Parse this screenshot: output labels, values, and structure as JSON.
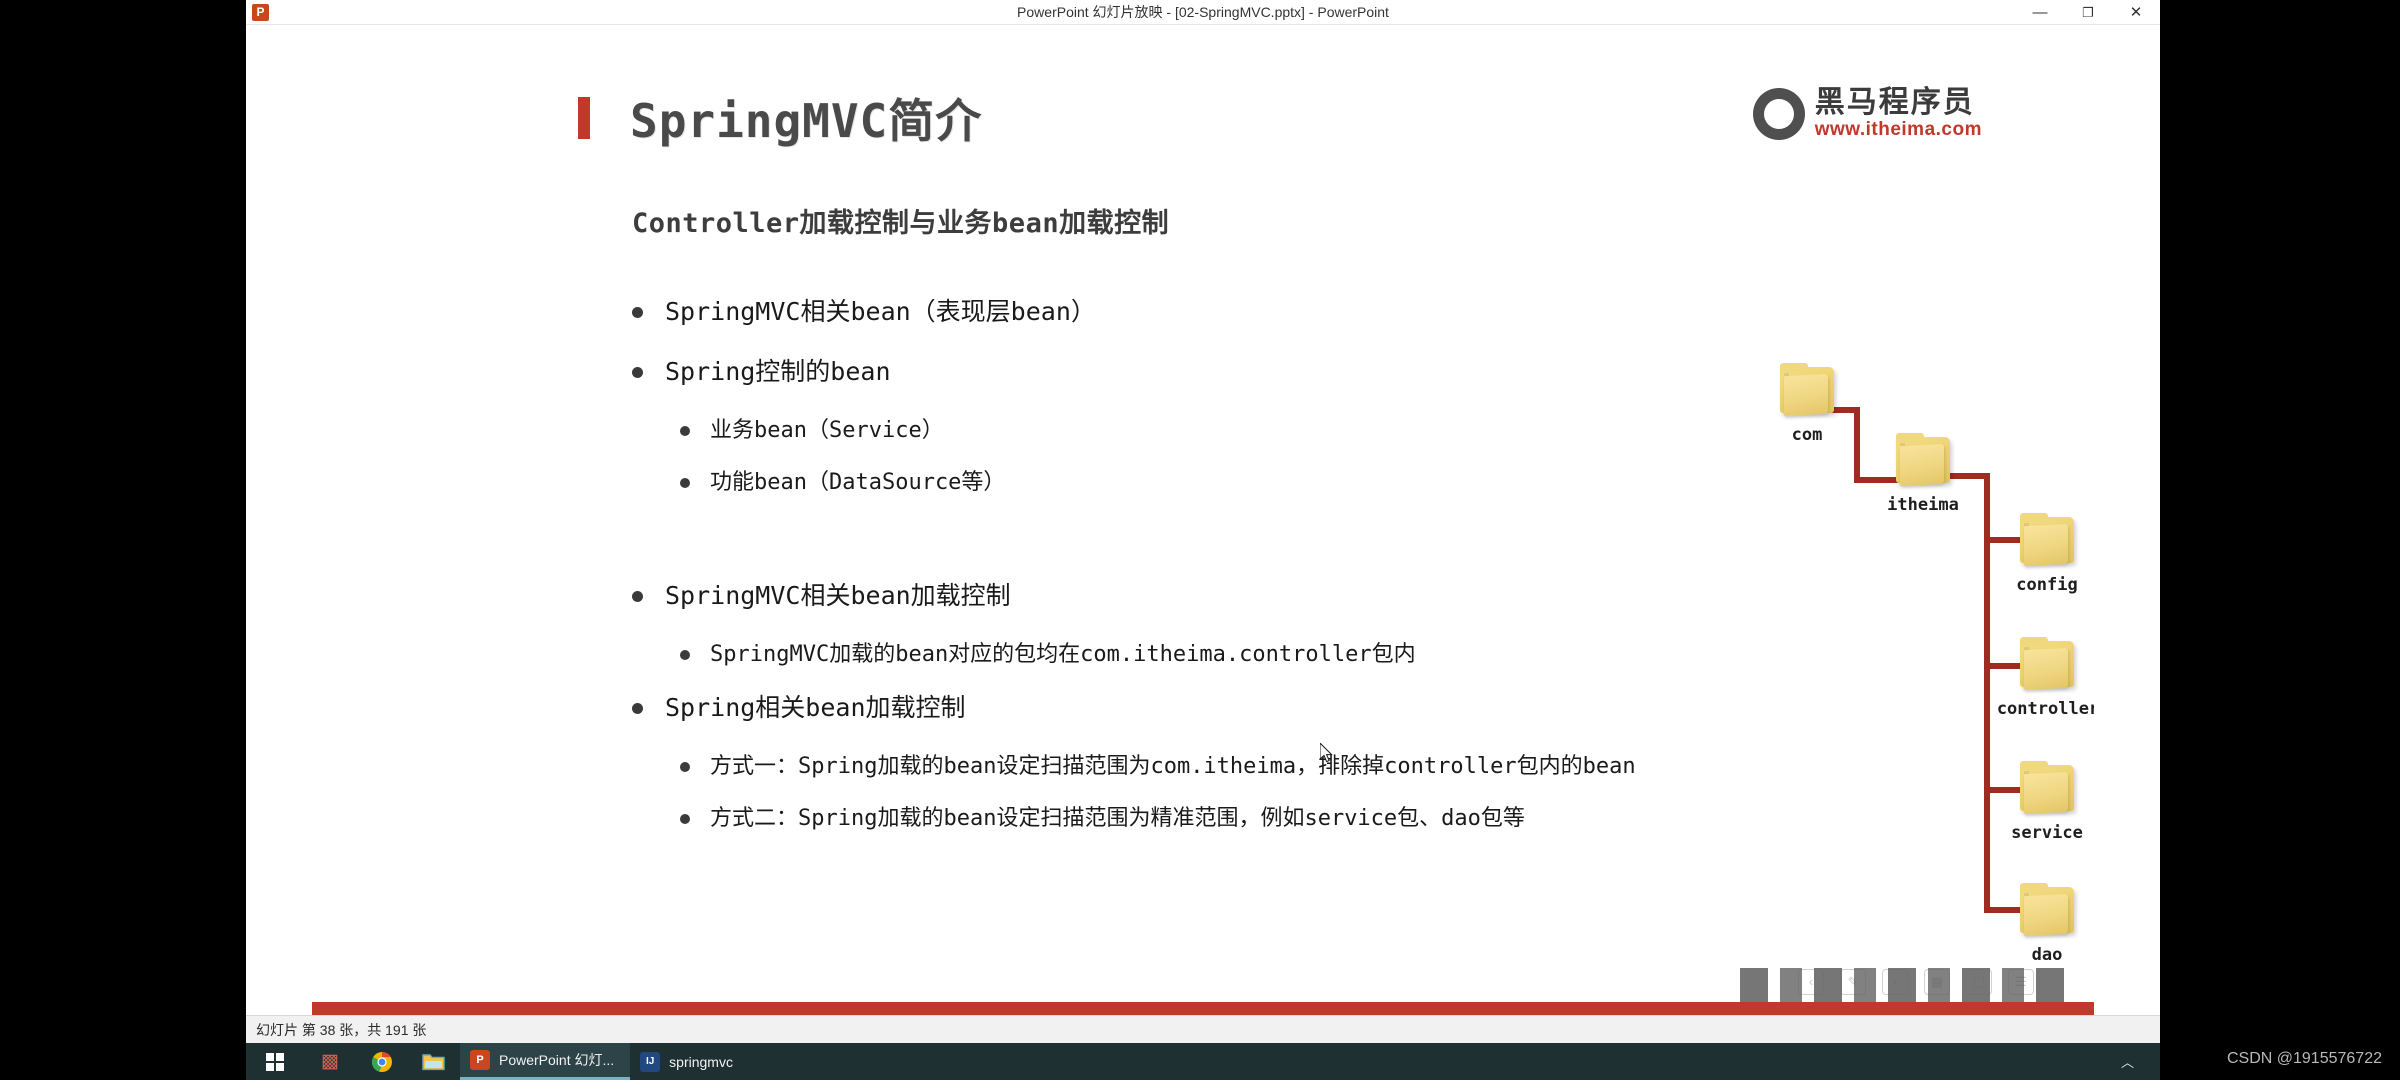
{
  "window": {
    "app_icon": "powerpoint-icon",
    "title": "PowerPoint 幻灯片放映 - [02-SpringMVC.pptx] - PowerPoint",
    "minimize_label": "—",
    "maximize_label": "❐",
    "close_label": "✕"
  },
  "slide": {
    "title": "SpringMVC简介",
    "subtitle": "Controller加载控制与业务bean加载控制",
    "accent_color": "#c0392b",
    "logo": {
      "name_cn": "黑马程序员",
      "url": "www.itheima.com",
      "mark_glyph": "⚘"
    },
    "group_a": [
      {
        "level": 1,
        "text": "SpringMVC相关bean（表现层bean）"
      },
      {
        "level": 1,
        "text": "Spring控制的bean"
      },
      {
        "level": 2,
        "text": "业务bean（Service）"
      },
      {
        "level": 2,
        "text": "功能bean（DataSource等）"
      }
    ],
    "group_b": [
      {
        "level": 1,
        "text": "SpringMVC相关bean加载控制"
      },
      {
        "level": 2,
        "text": "SpringMVC加载的bean对应的包均在com.itheima.controller包内"
      },
      {
        "level": 1,
        "text": "Spring相关bean加载控制"
      },
      {
        "level": 2,
        "text": "方式一：Spring加载的bean设定扫描范围为com.itheima，排除掉controller包内的bean"
      },
      {
        "level": 2,
        "text": "方式二：Spring加载的bean设定扫描范围为精准范围，例如service包、dao包等"
      }
    ],
    "tree": {
      "line_color": "#a02b20",
      "folder_color": "#f0d87e",
      "nodes": [
        {
          "id": "com",
          "label": "com"
        },
        {
          "id": "itheima",
          "label": "itheima"
        },
        {
          "id": "config",
          "label": "config"
        },
        {
          "id": "controller",
          "label": "controller"
        },
        {
          "id": "service",
          "label": "service"
        },
        {
          "id": "dao",
          "label": "dao"
        }
      ]
    },
    "show_controls": [
      {
        "name": "previous-slide-icon",
        "glyph": "‹"
      },
      {
        "name": "pen-tools-icon",
        "glyph": "✎"
      },
      {
        "name": "next-slide-icon",
        "glyph": "›"
      },
      {
        "name": "all-slides-icon",
        "glyph": "▦"
      },
      {
        "name": "zoom-icon",
        "glyph": "⬚"
      },
      {
        "name": "more-options-icon",
        "glyph": "☰"
      }
    ]
  },
  "statusbar": {
    "text": "幻灯片 第 38 张，共 191 张"
  },
  "taskbar": {
    "start_label": "start",
    "icons": [
      {
        "name": "firewall-icon",
        "glyph": "▩",
        "color": "#c0392b"
      },
      {
        "name": "chrome-icon",
        "glyph": "◉",
        "color": "#4285f4"
      },
      {
        "name": "file-explorer-icon",
        "glyph": "🗀",
        "color": "#f0c040"
      }
    ],
    "tasks": [
      {
        "name": "task-powerpoint",
        "label": "PowerPoint 幻灯...",
        "badge": "P",
        "badge_color": "#c9461f"
      },
      {
        "name": "task-intellij",
        "label": "springmvc",
        "badge": "IJ",
        "badge_color": "#21497f"
      }
    ],
    "tray_chevron": "︿"
  },
  "watermark": {
    "text": "CSDN @1915576722"
  }
}
